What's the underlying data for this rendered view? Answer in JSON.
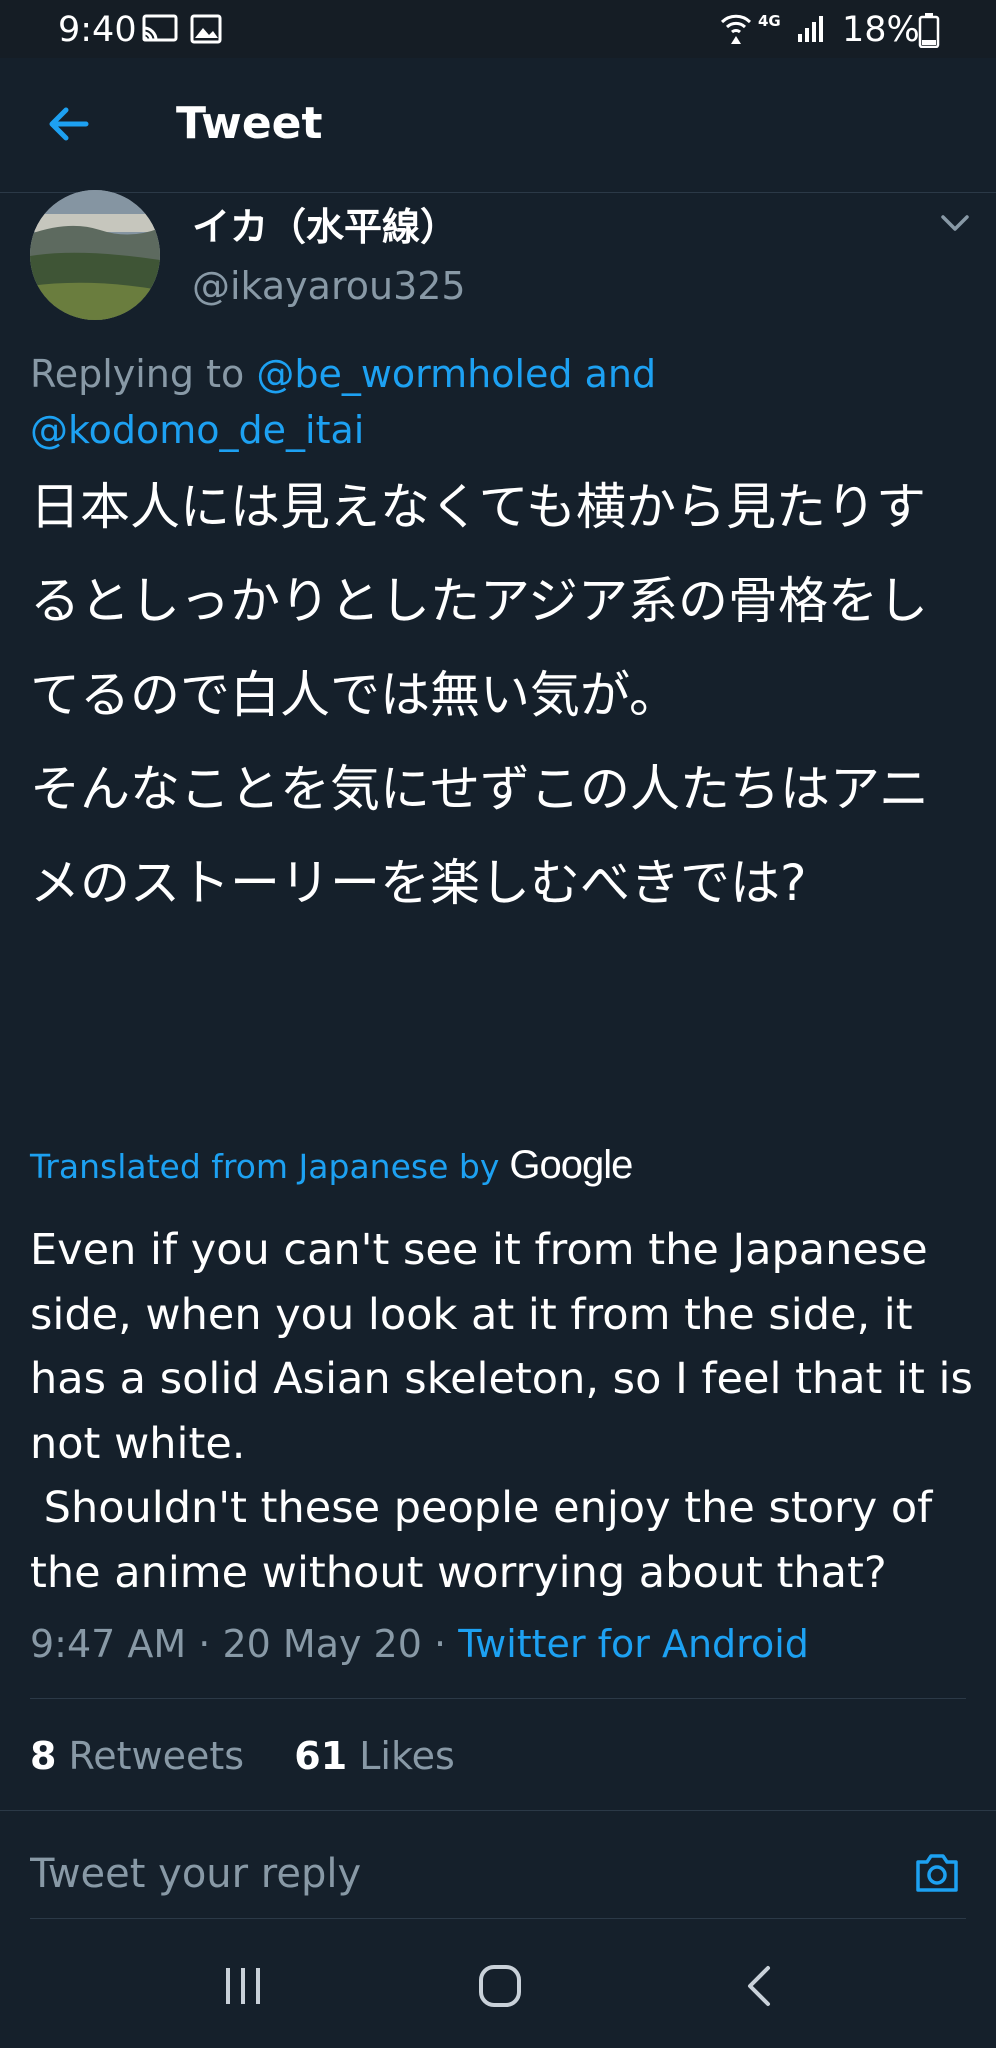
{
  "status_bar": {
    "time": "9:40",
    "battery_text": "18%",
    "network_type": "4G"
  },
  "header": {
    "title": "Tweet"
  },
  "tweet": {
    "author": {
      "display_name": "イカ（水平線）",
      "handle": "@ikayarou325"
    },
    "replying_to": {
      "prefix": "Replying to",
      "mention1": "@be_wormholed",
      "joiner": "and",
      "mention2": "@kodomo_de_itai"
    },
    "text_jp": "日本人には見えなくても横から見たりするとしっかりとしたアジア系の骨格をしてるので白人では無い気が。\nそんなことを気にせずこの人たちはアニメのストーリーを楽しむべきでは?",
    "translated_label": "Translated from Japanese by",
    "translator": "Google",
    "text_en": "Even if you can't see it from the Japanese side, when you look at it from the side, it has a solid Asian skeleton, so I feel that it is not white.\n Shouldn't these people enjoy the story of the anime without worrying about that?",
    "time": "9:47 AM",
    "date": "20 May 20",
    "separator": "·",
    "source": "Twitter for Android",
    "retweets_count": "8",
    "retweets_label": "Retweets",
    "likes_count": "61",
    "likes_label": "Likes"
  },
  "reply": {
    "placeholder": "Tweet your reply"
  },
  "colors": {
    "background": "#15202b",
    "accent": "#1da1f2",
    "muted_text": "#8899a6",
    "divider": "#2b3947"
  },
  "icons": [
    "cast-icon",
    "image-icon",
    "wifi-calling-icon",
    "signal-icon",
    "battery-icon",
    "back-arrow-icon",
    "chevron-down-icon",
    "camera-icon",
    "recents-icon",
    "home-icon",
    "back-icon"
  ]
}
